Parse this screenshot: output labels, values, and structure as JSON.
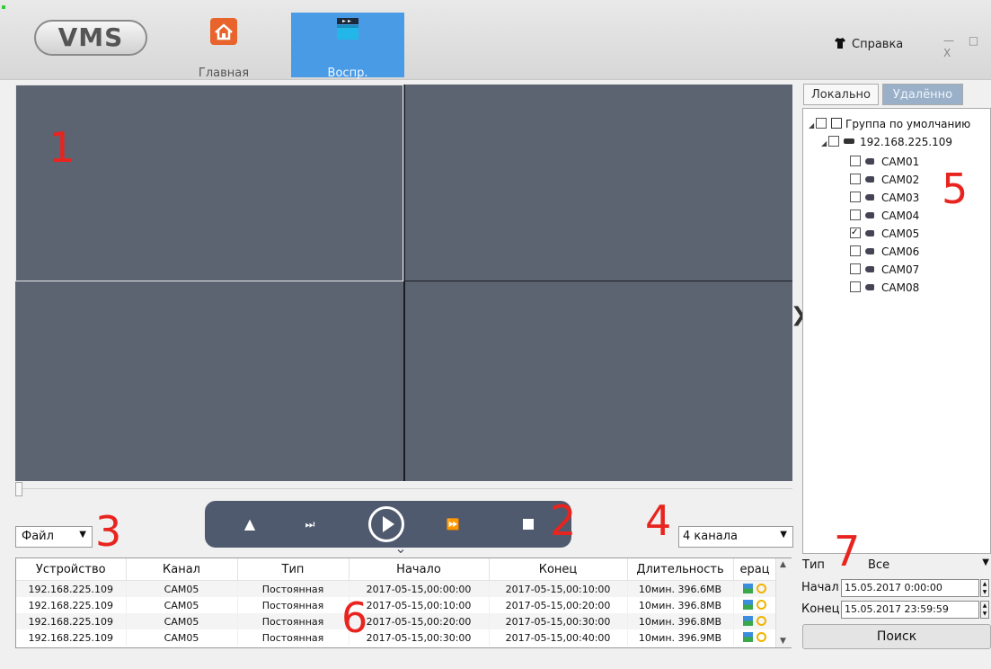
{
  "app": {
    "logo_text": "VMS"
  },
  "nav": {
    "home_label": "Главная",
    "playback_label": "Воспр."
  },
  "header": {
    "help_label": "Справка",
    "window_controls": "— □ X"
  },
  "markers": {
    "m1": "1",
    "m2": "2",
    "m3": "3",
    "m4": "4",
    "m5": "5",
    "m6": "6",
    "m7": "7"
  },
  "playback": {
    "file_select_value": "Файл",
    "channel_select_value": "4 канала",
    "buttons": {
      "eject": "▲",
      "step": "⏭",
      "fast_forward": "⏩"
    }
  },
  "table": {
    "columns": [
      "Устройство",
      "Канал",
      "Тип",
      "Начало",
      "Конец",
      "Длительность",
      "ерац"
    ],
    "rows": [
      [
        "192.168.225.109",
        "CAM05",
        "Постоянная",
        "2017-05-15,00:00:00",
        "2017-05-15,00:10:00",
        "10мин. 396.6MB"
      ],
      [
        "192.168.225.109",
        "CAM05",
        "Постоянная",
        "2017-05-15,00:10:00",
        "2017-05-15,00:20:00",
        "10мин. 396.8MB"
      ],
      [
        "192.168.225.109",
        "CAM05",
        "Постоянная",
        "2017-05-15,00:20:00",
        "2017-05-15,00:30:00",
        "10мин. 396.8MB"
      ],
      [
        "192.168.225.109",
        "CAM05",
        "Постоянная",
        "2017-05-15,00:30:00",
        "2017-05-15,00:40:00",
        "10мин. 396.9MB"
      ]
    ]
  },
  "panel": {
    "tab_local": "Локально",
    "tab_remote": "Удалённо",
    "tree": {
      "group": "Группа по умолчанию",
      "device": "192.168.225.109",
      "cameras": [
        {
          "name": "CAM01",
          "checked": false
        },
        {
          "name": "CAM02",
          "checked": false
        },
        {
          "name": "CAM03",
          "checked": false
        },
        {
          "name": "CAM04",
          "checked": false
        },
        {
          "name": "CAM05",
          "checked": true
        },
        {
          "name": "CAM06",
          "checked": false
        },
        {
          "name": "CAM07",
          "checked": false
        },
        {
          "name": "CAM08",
          "checked": false
        }
      ]
    }
  },
  "search": {
    "type_label": "Тип",
    "type_value": "Все",
    "start_label": "Начал",
    "start_value": "15.05.2017 0:00:00",
    "end_label": "Конец",
    "end_value": "15.05.2017 23:59:59",
    "button": "Поиск"
  },
  "colors": {
    "accent": "#4a9be6",
    "marker_red": "#e8241f",
    "video_bg": "#5c6472",
    "control_bar": "#4f5a6e"
  }
}
